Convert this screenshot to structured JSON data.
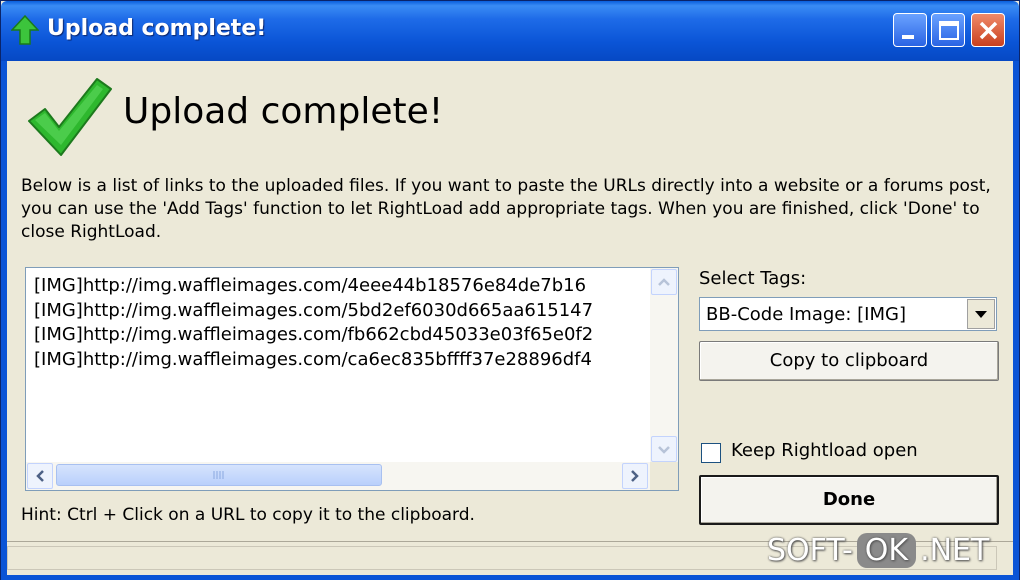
{
  "window": {
    "title": "Upload complete!"
  },
  "heading": "Upload complete!",
  "description": "Below is a list of links to the uploaded files. If you want to paste the URLs directly into a website or a forums post, you can use the 'Add Tags' function to let RightLoad add appropriate tags. When you are finished, click 'Done' to close RightLoad.",
  "links": [
    "[IMG]http://img.waffleimages.com/4eee44b18576e84de7b16",
    "[IMG]http://img.waffleimages.com/5bd2ef6030d665aa615147",
    "[IMG]http://img.waffleimages.com/fb662cbd45033e03f65e0f2",
    "[IMG]http://img.waffleimages.com/ca6ec835bffff37e28896df4"
  ],
  "hint": "Hint: Ctrl + Click on a URL to copy it to the clipboard.",
  "tags": {
    "label": "Select Tags:",
    "selected": "BB-Code Image: [IMG]"
  },
  "buttons": {
    "copy": "Copy to clipboard",
    "done": "Done"
  },
  "keep_open": {
    "label": "Keep Rightload open",
    "checked": false
  },
  "watermark": {
    "left": "SOFT-",
    "ok": "OK",
    "right": ".NET"
  },
  "colors": {
    "titlebar": "#0a54d6",
    "check_green": "#2eb82e",
    "background": "#ece9d8"
  }
}
